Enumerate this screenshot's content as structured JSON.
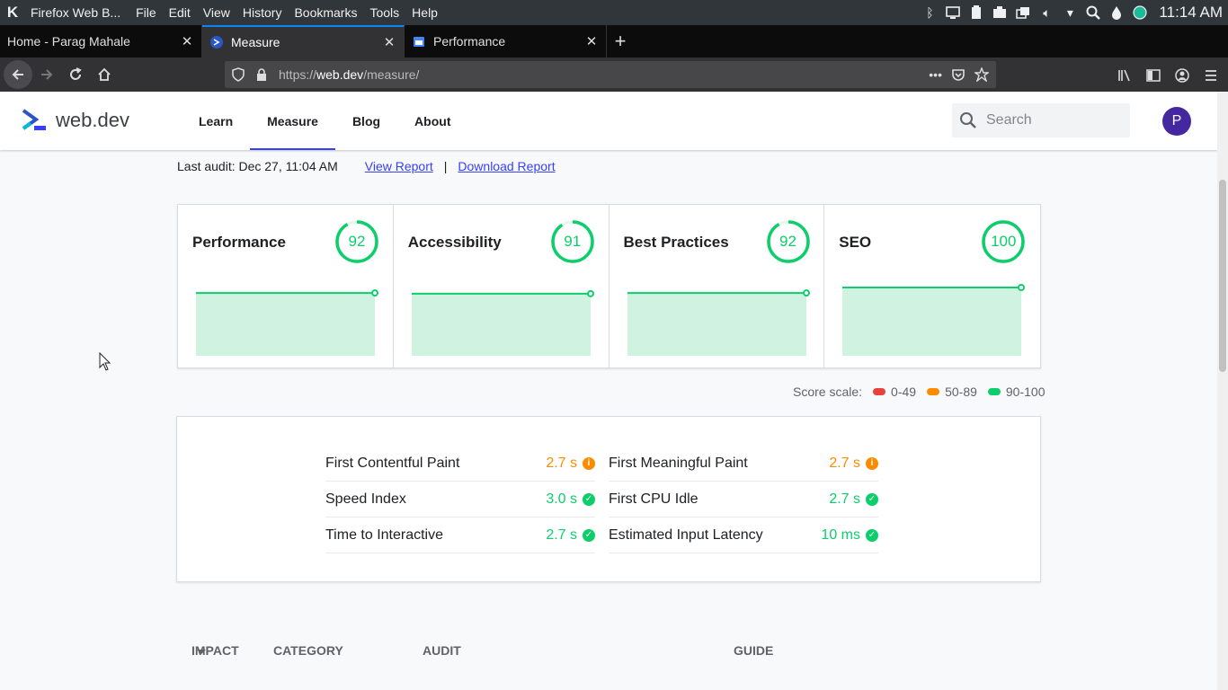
{
  "os": {
    "app_title": "Firefox Web B...",
    "menu": [
      "File",
      "Edit",
      "View",
      "History",
      "Bookmarks",
      "Tools",
      "Help"
    ],
    "clock": "11:14 AM"
  },
  "tabs": [
    {
      "label": "Home - Parag Mahale",
      "active": false
    },
    {
      "label": "Measure",
      "active": true
    },
    {
      "label": "Performance",
      "active": false
    }
  ],
  "url": {
    "prefix": "https://",
    "host": "web.dev",
    "path": "/measure/"
  },
  "site": {
    "brand": "web.dev",
    "nav": [
      {
        "label": "Learn",
        "active": false
      },
      {
        "label": "Measure",
        "active": true
      },
      {
        "label": "Blog",
        "active": false
      },
      {
        "label": "About",
        "active": false
      }
    ],
    "search_placeholder": "Search",
    "avatar_letter": "P"
  },
  "audit": {
    "last_audit": "Last audit: Dec 27, 11:04 AM",
    "view_report": "View Report",
    "separator": "|",
    "download_report": "Download Report"
  },
  "scores": [
    {
      "title": "Performance",
      "score": 92
    },
    {
      "title": "Accessibility",
      "score": 91
    },
    {
      "title": "Best Practices",
      "score": 92
    },
    {
      "title": "SEO",
      "score": 100
    }
  ],
  "score_scale": {
    "label": "Score scale:",
    "ranges": [
      {
        "label": "0-49",
        "color": "#e8433a"
      },
      {
        "label": "50-89",
        "color": "#fb8c00"
      },
      {
        "label": "90-100",
        "color": "#0cce6b"
      }
    ]
  },
  "metrics": {
    "left": [
      {
        "label": "First Contentful Paint",
        "value": "2.7 s",
        "status": "average"
      },
      {
        "label": "Speed Index",
        "value": "3.0 s",
        "status": "pass"
      },
      {
        "label": "Time to Interactive",
        "value": "2.7 s",
        "status": "pass"
      }
    ],
    "right": [
      {
        "label": "First Meaningful Paint",
        "value": "2.7 s",
        "status": "average"
      },
      {
        "label": "First CPU Idle",
        "value": "2.7 s",
        "status": "pass"
      },
      {
        "label": "Estimated Input Latency",
        "value": "10 ms",
        "status": "pass"
      }
    ]
  },
  "colors": {
    "pass": "#0cce6b",
    "average": "#fb8c00",
    "accent": "#3740ff"
  },
  "table_head": {
    "impact": "IMPACT",
    "category": "CATEGORY",
    "audit": "AUDIT",
    "guide": "GUIDE"
  }
}
